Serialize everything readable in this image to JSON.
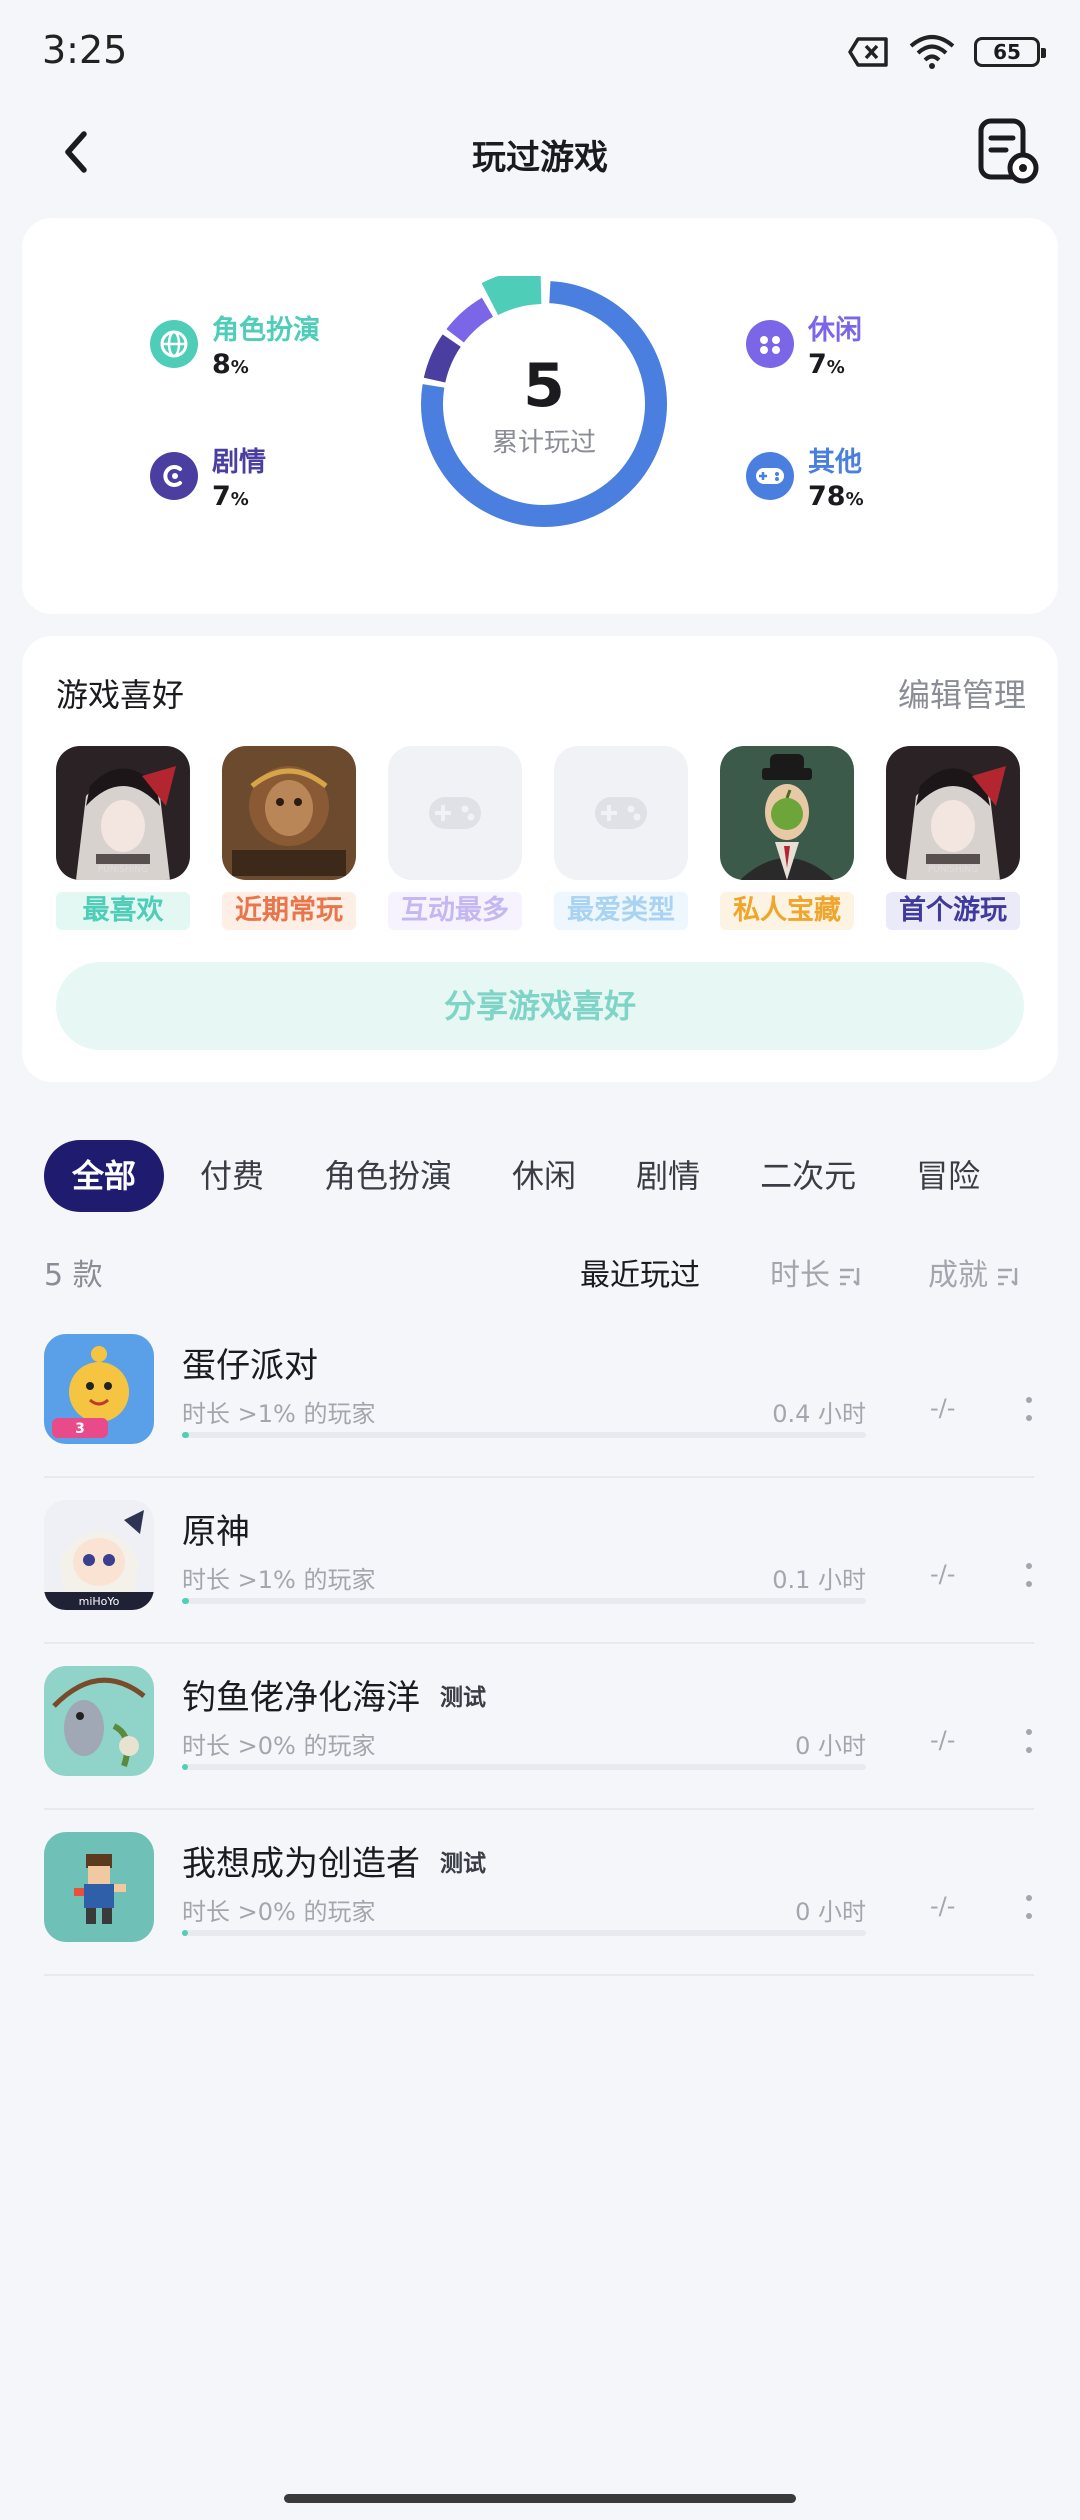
{
  "status_bar": {
    "time": "3:25",
    "battery": "65"
  },
  "header": {
    "title": "玩过游戏"
  },
  "stats": {
    "total": "5",
    "total_label": "累计玩过",
    "categories": [
      {
        "name": "角色扮演",
        "pct": "8",
        "unit": "%",
        "color": "#4ecdb8",
        "icon": "globe-icon"
      },
      {
        "name": "剧情",
        "pct": "7",
        "unit": "%",
        "color": "#4a3fa0",
        "icon": "story-icon"
      },
      {
        "name": "休闲",
        "pct": "7",
        "unit": "%",
        "color": "#7a66e6",
        "icon": "gamepad-icon"
      },
      {
        "name": "其他",
        "pct": "78",
        "unit": "%",
        "color": "#4a7fe0",
        "icon": "controller-icon"
      }
    ]
  },
  "preferences": {
    "title": "游戏喜好",
    "manage": "编辑管理",
    "items": [
      {
        "label": "最喜欢",
        "color": "#4ecdb8",
        "bg": "#e3f7f3"
      },
      {
        "label": "近期常玩",
        "color": "#e8764a",
        "bg": "#fdeee6"
      },
      {
        "label": "互动最多",
        "color": "#c4b8f2",
        "bg": "#f6f3fe"
      },
      {
        "label": "最爱类型",
        "color": "#a9d3f2",
        "bg": "#eff7fe"
      },
      {
        "label": "私人宝藏",
        "color": "#f0a52c",
        "bg": "#fdf3e2"
      },
      {
        "label": "首个游玩",
        "color": "#3f3a9c",
        "bg": "#ebeaf8"
      }
    ],
    "share": "分享游戏喜好"
  },
  "tabs": [
    "全部",
    "付费",
    "角色扮演",
    "休闲",
    "剧情",
    "二次元",
    "冒险"
  ],
  "sort": {
    "count": "5 款",
    "recent": "最近玩过",
    "duration": "时长",
    "achievement": "成就"
  },
  "games": [
    {
      "name": "蛋仔派对",
      "badge": "",
      "desc": "时长 >1% 的玩家",
      "hours": "0.4 小时",
      "ach": "-/-",
      "progress": 0.01
    },
    {
      "name": "原神",
      "badge": "",
      "desc": "时长 >1% 的玩家",
      "hours": "0.1 小时",
      "ach": "-/-",
      "progress": 0.01
    },
    {
      "name": "钓鱼佬净化海洋",
      "badge": "测试",
      "desc": "时长 >0% 的玩家",
      "hours": "0 小时",
      "ach": "-/-",
      "progress": 0.005
    },
    {
      "name": "我想成为创造者",
      "badge": "测试",
      "desc": "时长 >0% 的玩家",
      "hours": "0 小时",
      "ach": "-/-",
      "progress": 0.005
    }
  ]
}
